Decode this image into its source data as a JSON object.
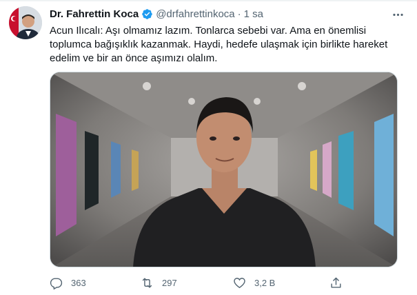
{
  "author": {
    "name": "Dr. Fahrettin Koca",
    "handle": "@drfahrettinkoca",
    "separator": "·",
    "time": "1 sa",
    "verified": true
  },
  "tweet": {
    "text": "Acun Ilıcalı: Aşı olmamız lazım. Tonlarca sebebi var. Ama en önemlisi toplumca bağışıklık kazanmak. Haydi, hedefe ulaşmak için birlikte hareket edelim ve bir an önce aşımızı olalım."
  },
  "actions": {
    "replies": "363",
    "retweets": "297",
    "likes": "3,2 B"
  },
  "icons": {
    "more": "more-horizontal-icon",
    "reply": "reply-icon",
    "retweet": "retweet-icon",
    "like": "heart-icon",
    "share": "share-icon",
    "verified": "verified-badge-icon"
  },
  "colors": {
    "accent": "#1d9bf0",
    "text": "#0f1419",
    "muted": "#536471",
    "border": "#cfd9de"
  }
}
